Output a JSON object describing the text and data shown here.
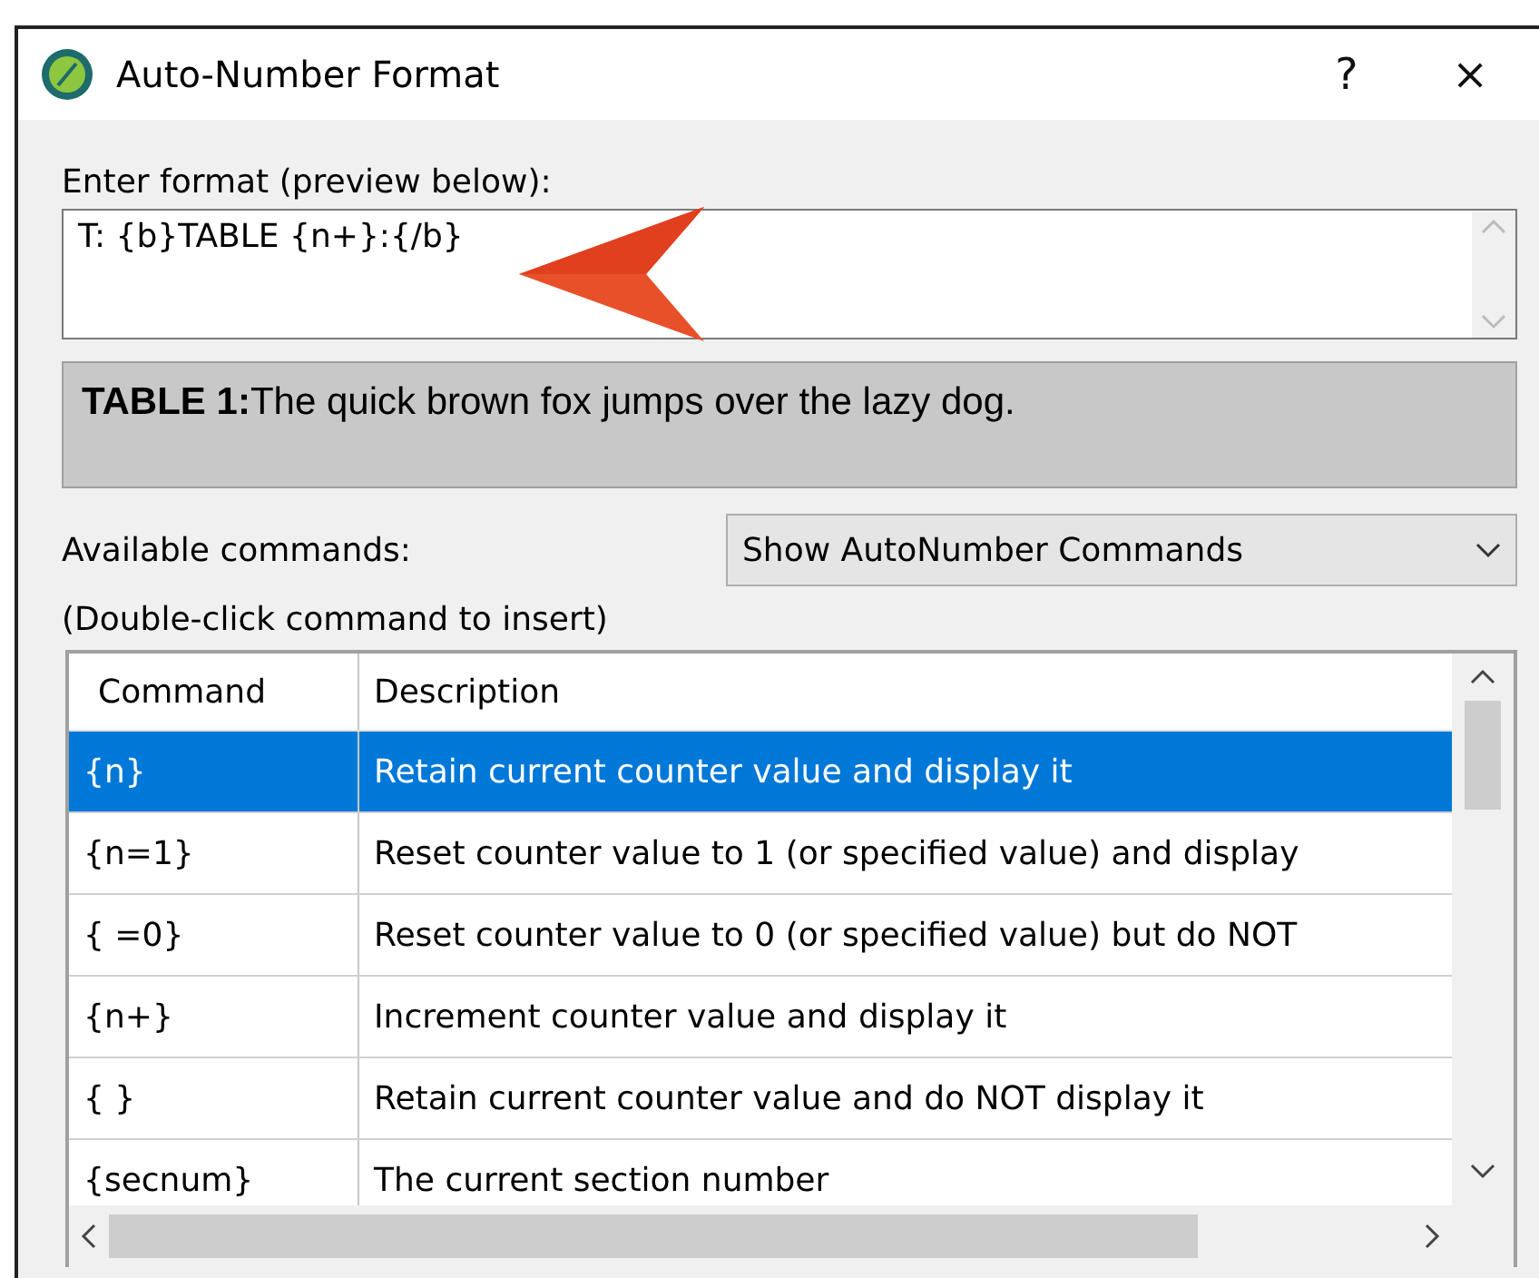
{
  "window": {
    "title": "Auto-Number Format",
    "help": "?",
    "close": "×"
  },
  "format": {
    "label": "Enter format (preview below):",
    "value": "T: {b}TABLE {n+}:{/b}"
  },
  "preview": {
    "text": "**TABLE 1:**The quick brown fox jumps over the lazy dog."
  },
  "commands": {
    "label": "Available commands:",
    "dropdown": "Show AutoNumber Commands",
    "hint": "(Double-click command to insert)"
  },
  "table": {
    "columns": [
      "Command",
      "Description"
    ],
    "rows": [
      {
        "command": "{n}",
        "description": "Retain current counter value and display it",
        "selected": true
      },
      {
        "command": "{n=1}",
        "description": "Reset counter value to 1 (or specified value) and display",
        "selected": false
      },
      {
        "command": "{ =0}",
        "description": "Reset counter value to 0 (or specified value) but do NOT",
        "selected": false
      },
      {
        "command": "{n+}",
        "description": "Increment counter value and display it",
        "selected": false
      },
      {
        "command": "{ }",
        "description": "Retain current counter value and do NOT display it",
        "selected": false
      },
      {
        "command": "{secnum}",
        "description": "The current section number",
        "selected": false
      }
    ]
  }
}
